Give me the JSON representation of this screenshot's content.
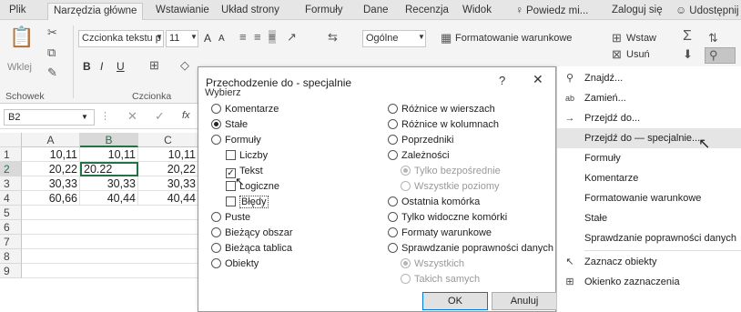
{
  "tabs": [
    {
      "label": "Plik"
    },
    {
      "label": "Narzędzia główne"
    },
    {
      "label": "Wstawianie"
    },
    {
      "label": "Układ strony"
    },
    {
      "label": "Formuły"
    },
    {
      "label": "Dane"
    },
    {
      "label": "Recenzja"
    },
    {
      "label": "Widok"
    },
    {
      "label": "Powiedz mi..."
    },
    {
      "label": "Zaloguj się"
    },
    {
      "label": "Udostępnij"
    }
  ],
  "ribbon": {
    "paste_label": "Wklej",
    "font_name": "Czcionka tekstu p",
    "font_size": "11",
    "number_format": "Ogólne",
    "conditional_formatting": "Formatowanie warunkowe",
    "insert_label": "Wstaw",
    "delete_label": "Usuń",
    "group_clipboard": "Schowek",
    "group_font": "Czcionka",
    "bold": "B",
    "italic": "I",
    "underline": "U",
    "grow_font": "A",
    "shrink_font": "A"
  },
  "formula_bar": {
    "name_box": "B2",
    "fx": "fx"
  },
  "grid": {
    "columns": [
      "A",
      "B",
      "C"
    ],
    "rows": [
      "1",
      "2",
      "3",
      "4",
      "5",
      "6",
      "7",
      "8",
      "9"
    ],
    "cells": [
      [
        "10,11",
        "10,11",
        "10,11"
      ],
      [
        "20,22",
        "20.22",
        "20,22"
      ],
      [
        "30,33",
        "30,33",
        "30,33"
      ],
      [
        "60,66",
        "40,44",
        "40,44"
      ]
    ]
  },
  "dialog": {
    "title": "Przechodzenie do - specjalnie",
    "help": "?",
    "close": "✕",
    "group_label": "Wybierz",
    "left_options": [
      {
        "label": "Komentarze"
      },
      {
        "label": "Stałe"
      },
      {
        "label": "Formuły"
      },
      {
        "label": "Liczby"
      },
      {
        "label": "Tekst"
      },
      {
        "label": "Logiczne"
      },
      {
        "label": "Błędy"
      },
      {
        "label": "Puste"
      },
      {
        "label": "Bieżący obszar"
      },
      {
        "label": "Bieżąca tablica"
      },
      {
        "label": "Obiekty"
      }
    ],
    "right_options": [
      {
        "label": "Różnice w wierszach"
      },
      {
        "label": "Różnice w kolumnach"
      },
      {
        "label": "Poprzedniki"
      },
      {
        "label": "Zależności"
      },
      {
        "label": "Tylko bezpośrednie"
      },
      {
        "label": "Wszystkie poziomy"
      },
      {
        "label": "Ostatnia komórka"
      },
      {
        "label": "Tylko widoczne komórki"
      },
      {
        "label": "Formaty warunkowe"
      },
      {
        "label": "Sprawdzanie poprawności danych"
      },
      {
        "label": "Wszystkich"
      },
      {
        "label": "Takich samych"
      }
    ],
    "ok_label": "OK",
    "cancel_label": "Anuluj"
  },
  "menu": {
    "items": [
      {
        "label": "Znajdź...",
        "icon": "binoculars-icon"
      },
      {
        "label": "Zamień...",
        "icon": "replace-icon"
      },
      {
        "label": "Przejdź do...",
        "icon": "arrow-right-icon"
      },
      {
        "label": "Przejdź do — specjalnie..."
      },
      {
        "label": "Formuły"
      },
      {
        "label": "Komentarze"
      },
      {
        "label": "Formatowanie warunkowe"
      },
      {
        "label": "Stałe"
      },
      {
        "label": "Sprawdzanie poprawności danych"
      },
      {
        "label": "Zaznacz obiekty",
        "icon": "select-objects-icon"
      },
      {
        "label": "Okienko zaznaczenia",
        "icon": "selection-pane-icon"
      }
    ]
  },
  "colors": {
    "accent_green": "#217346",
    "ribbon_bg": "#f4f4f4",
    "hover_bg": "#e5e5e5"
  }
}
